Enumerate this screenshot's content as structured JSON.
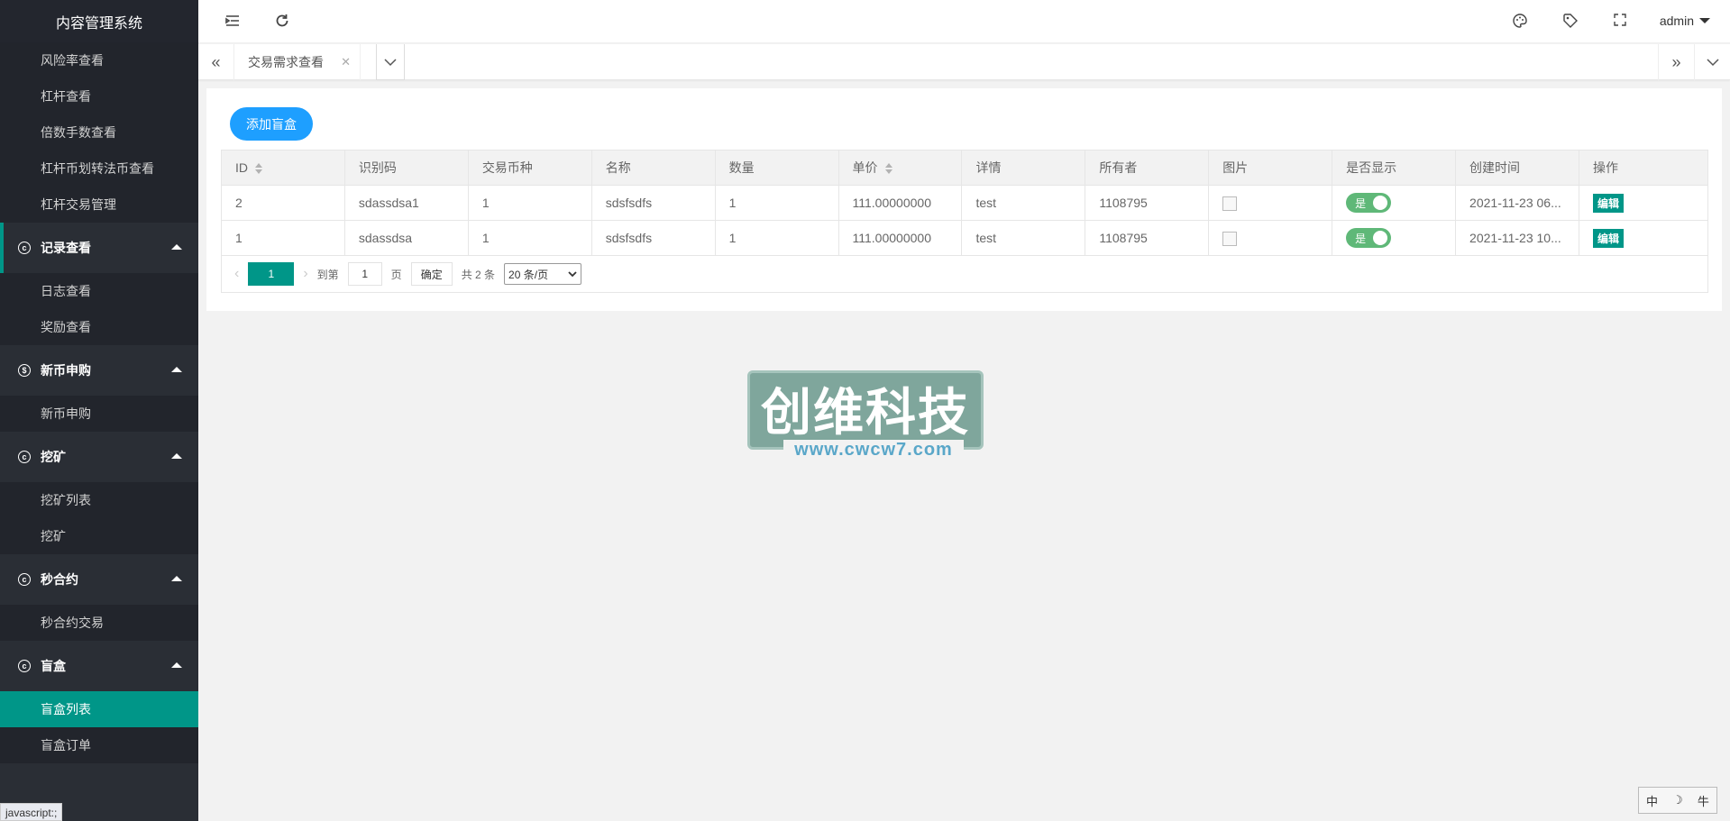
{
  "app": {
    "title": "内容管理系统"
  },
  "sidebar": {
    "top_items": [
      "风险率查看",
      "杠杆查看",
      "倍数手数查看",
      "杠杆币划转法币查看",
      "杠杆交易管理"
    ],
    "groups": [
      {
        "label": "记录查看",
        "icon": "record-icon",
        "items": [
          "日志查看",
          "奖励查看"
        ]
      },
      {
        "label": "新币申购",
        "icon": "dollar-icon",
        "items": [
          "新币申购"
        ]
      },
      {
        "label": "挖矿",
        "icon": "mining-icon",
        "items": [
          "挖矿列表",
          "挖矿"
        ]
      },
      {
        "label": "秒合约",
        "icon": "contract-icon",
        "items": [
          "秒合约交易"
        ]
      },
      {
        "label": "盲盒",
        "icon": "box-icon",
        "items": [
          "盲盒列表",
          "盲盒订单"
        ]
      }
    ],
    "active_item": "盲盒列表",
    "status_tip": "javascript:;"
  },
  "header": {
    "user": "admin"
  },
  "tabs": {
    "items": [
      {
        "label": "交易需求查看"
      }
    ]
  },
  "toolbar": {
    "add_label": "添加盲盒"
  },
  "table": {
    "columns": [
      "ID",
      "识别码",
      "交易币种",
      "名称",
      "数量",
      "单价",
      "详情",
      "所有者",
      "图片",
      "是否显示",
      "创建时间",
      "操作"
    ],
    "rows": [
      {
        "id": "2",
        "code": "sdassdsa1",
        "currency": "1",
        "name": "sdsfsdfs",
        "qty": "1",
        "price": "111.00000000",
        "detail": "test",
        "owner": "1108795",
        "show": "是",
        "created": "2021-11-23 06...",
        "action": "编辑"
      },
      {
        "id": "1",
        "code": "sdassdsa",
        "currency": "1",
        "name": "sdsfsdfs",
        "qty": "1",
        "price": "111.00000000",
        "detail": "test",
        "owner": "1108795",
        "show": "是",
        "created": "2021-11-23 10...",
        "action": "编辑"
      }
    ]
  },
  "pager": {
    "current": "1",
    "goto_label": "到第",
    "goto_value": "1",
    "page_label": "页",
    "ok_label": "确定",
    "total": "共 2 条",
    "page_size": "20 条/页"
  },
  "watermark": {
    "text": "创维科技",
    "url": "www.cwcw7.com"
  },
  "ime": {
    "labels": [
      "中",
      "☽",
      "牛"
    ]
  }
}
